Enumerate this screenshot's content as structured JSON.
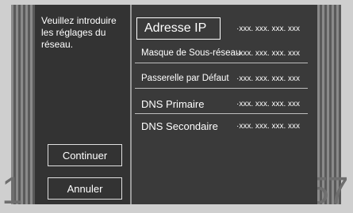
{
  "instruction": "Veuillez introduire les réglages du réseau.",
  "buttons": {
    "continue": "Continuer",
    "cancel": "Annuler"
  },
  "fields": {
    "ip": {
      "label": "Adresse IP",
      "value": "·xxx. xxx. xxx. xxx"
    },
    "mask": {
      "label": "Masque de Sous-réseau",
      "value": "·xxx. xxx. xxx. xxx"
    },
    "gateway": {
      "label": "Passerelle par Défaut",
      "value": "·xxx. xxx. xxx. xxx"
    },
    "dns1": {
      "label": "DNS Primaire",
      "value": "·xxx. xxx. xxx. xxx"
    },
    "dns2": {
      "label": "DNS Secondaire",
      "value": "·xxx. xxx. xxx. xxx"
    }
  },
  "ghost_numbers": {
    "left": "1",
    "right": "57"
  }
}
